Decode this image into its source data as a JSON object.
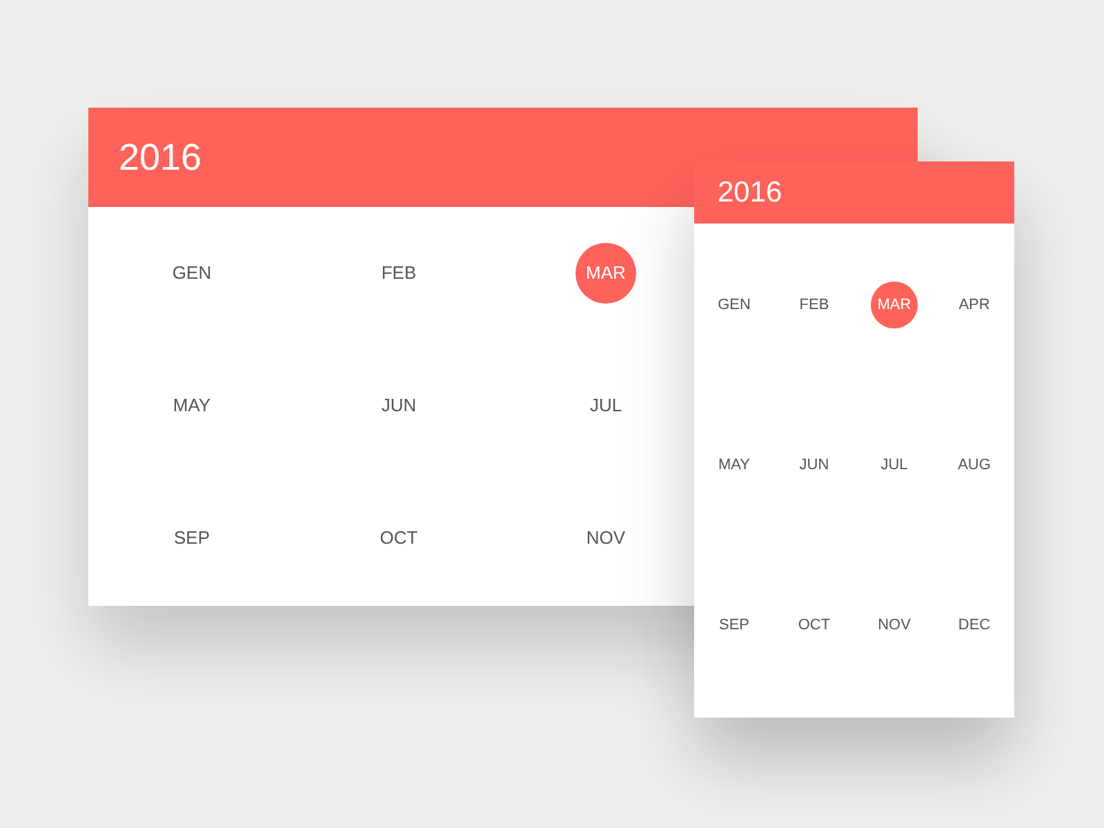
{
  "calendars": [
    {
      "kind": "wide",
      "year": "2016",
      "months": [
        {
          "label": "GEN",
          "selected": false
        },
        {
          "label": "FEB",
          "selected": false
        },
        {
          "label": "MAR",
          "selected": true
        },
        {
          "label": "MAY",
          "selected": false
        },
        {
          "label": "JUN",
          "selected": false
        },
        {
          "label": "JUL",
          "selected": false
        },
        {
          "label": "SEP",
          "selected": false
        },
        {
          "label": "OCT",
          "selected": false
        },
        {
          "label": "NOV",
          "selected": false
        }
      ]
    },
    {
      "kind": "compact",
      "year": "2016",
      "months": [
        {
          "label": "GEN",
          "selected": false
        },
        {
          "label": "FEB",
          "selected": false
        },
        {
          "label": "MAR",
          "selected": true
        },
        {
          "label": "APR",
          "selected": false
        },
        {
          "label": "MAY",
          "selected": false
        },
        {
          "label": "JUN",
          "selected": false
        },
        {
          "label": "JUL",
          "selected": false
        },
        {
          "label": "AUG",
          "selected": false
        },
        {
          "label": "SEP",
          "selected": false
        },
        {
          "label": "OCT",
          "selected": false
        },
        {
          "label": "NOV",
          "selected": false
        },
        {
          "label": "DEC",
          "selected": false
        }
      ]
    }
  ]
}
